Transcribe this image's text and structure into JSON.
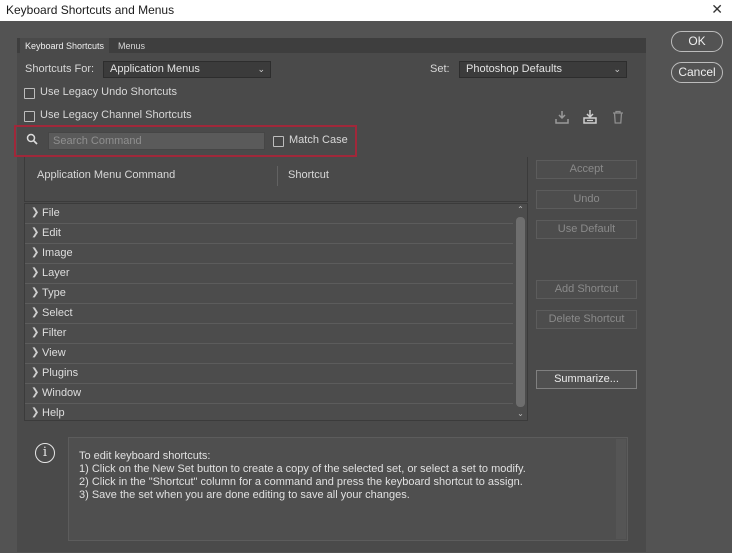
{
  "window": {
    "title": "Keyboard Shortcuts and Menus",
    "close_glyph": "✕"
  },
  "tabs": [
    {
      "label": "Keyboard Shortcuts",
      "active": true
    },
    {
      "label": "Menus",
      "active": false
    }
  ],
  "shortcuts_for": {
    "label": "Shortcuts For:",
    "value": "Application Menus"
  },
  "set": {
    "label": "Set:",
    "value": "Photoshop Defaults"
  },
  "options": {
    "legacy_undo": {
      "label": "Use Legacy Undo Shortcuts",
      "checked": false
    },
    "legacy_channel": {
      "label": "Use Legacy Channel Shortcuts",
      "checked": false
    }
  },
  "icons": {
    "save_set": "download-icon",
    "new_set": "new-set-icon",
    "delete_set": "trash-icon",
    "search": "search-icon",
    "info": "info-icon"
  },
  "search": {
    "placeholder": "Search Command",
    "match_case_label": "Match Case",
    "match_case_checked": false
  },
  "table": {
    "column_command": "Application Menu Command",
    "column_shortcut": "Shortcut",
    "rows": [
      "File",
      "Edit",
      "Image",
      "Layer",
      "Type",
      "Select",
      "Filter",
      "View",
      "Plugins",
      "Window",
      "Help"
    ]
  },
  "side_buttons": {
    "accept": "Accept",
    "undo": "Undo",
    "use_default": "Use Default",
    "add_shortcut": "Add Shortcut",
    "delete_shortcut": "Delete Shortcut",
    "summarize": "Summarize..."
  },
  "dialog_buttons": {
    "ok": "OK",
    "cancel": "Cancel"
  },
  "info": {
    "lines": [
      "To edit keyboard shortcuts:",
      "1) Click on the New Set button to create a copy of the selected set, or select a set to modify.",
      "2) Click in the \"Shortcut\" column for a command and press the keyboard shortcut to assign.",
      "3) Save the set when you are done editing to save all your changes."
    ]
  },
  "colors": {
    "accent_highlight": "#a0283a",
    "background": "#535353",
    "panel": "#4a4a4a"
  }
}
